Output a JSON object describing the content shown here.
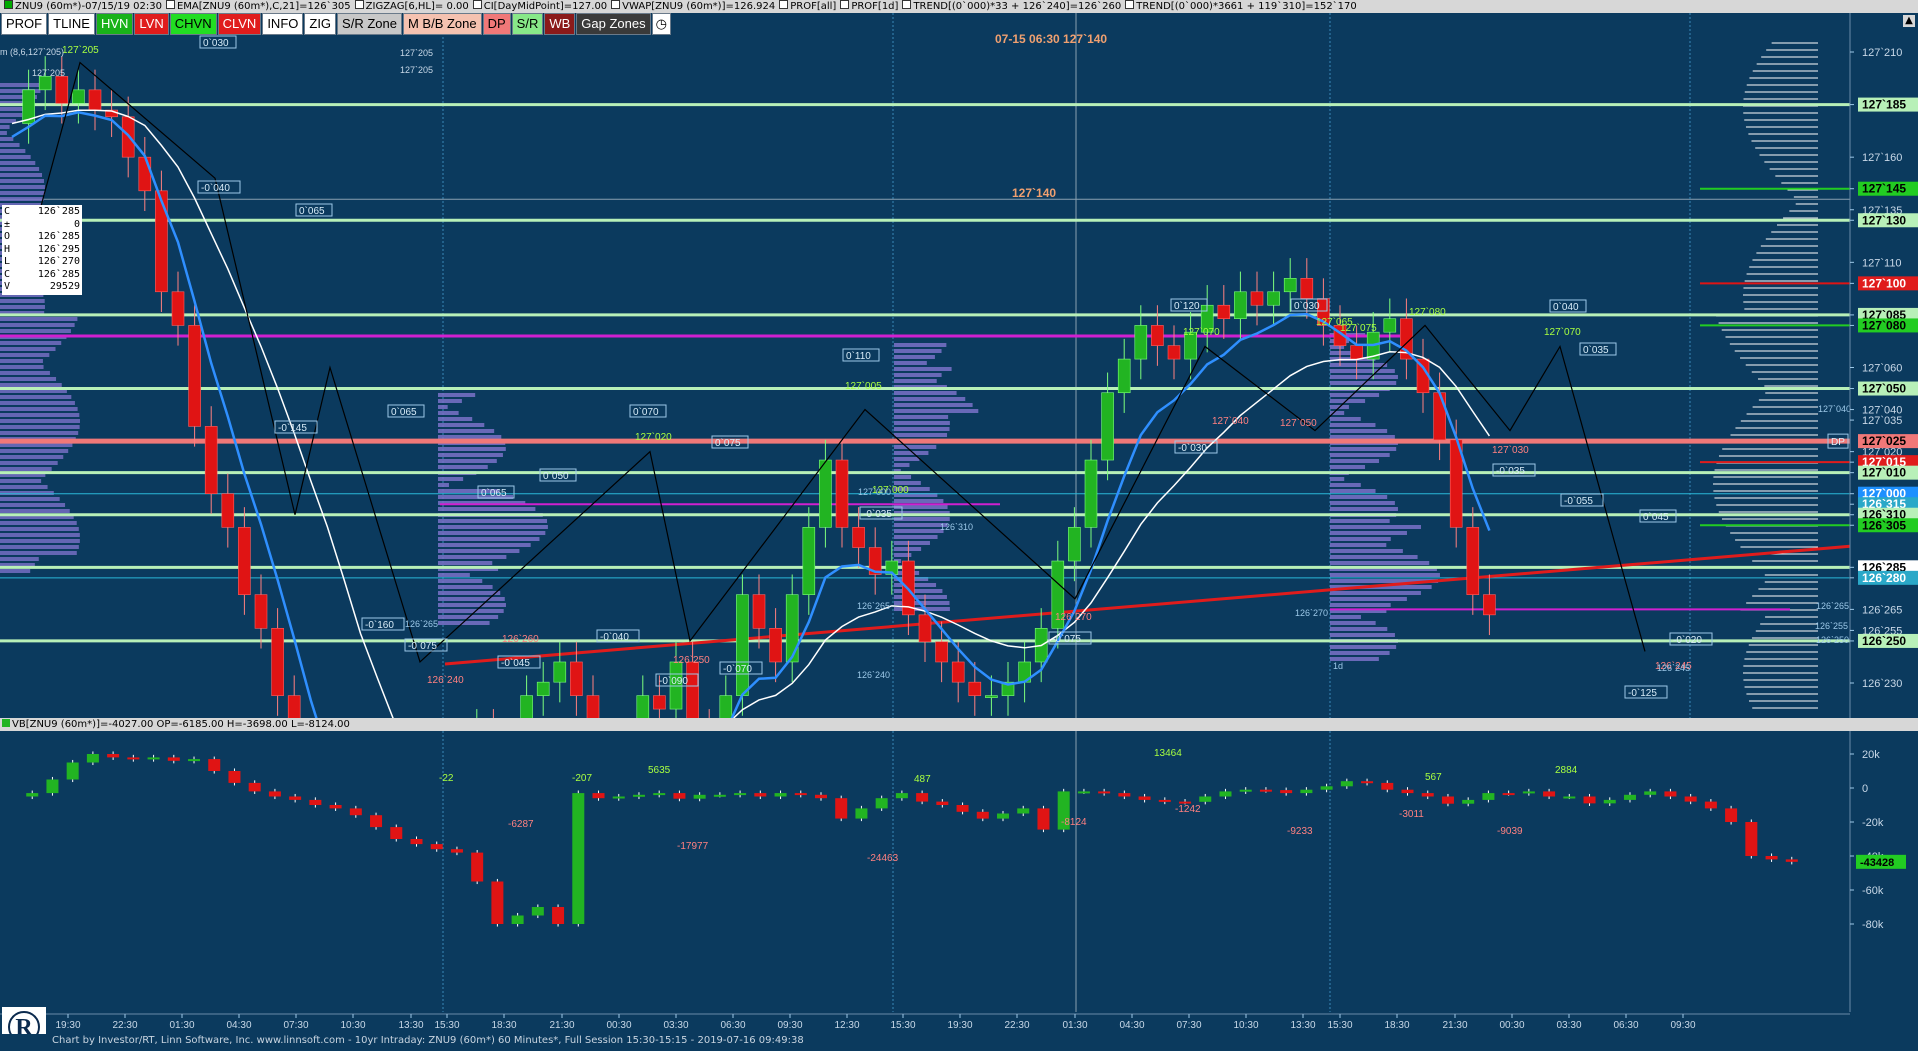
{
  "window": {
    "title_segments": [
      {
        "text": "ZNU9 (60m*)-07/15/19 02:30",
        "color": "#000000"
      },
      {
        "text": "EMA[ZNU9 (60m*),C,21]=126`305",
        "color": "#000000"
      },
      {
        "text": "ZIGZAG[6,HL]= 0.00",
        "color": "#000000"
      },
      {
        "text": "CI[DayMidPoint]=127.00",
        "color": "#000000"
      },
      {
        "text": "VWAP[ZNU9 (60m*)]=126.924",
        "color": "#000000"
      },
      {
        "text": "PROF[all]",
        "color": "#000000"
      },
      {
        "text": "PROF[1d]",
        "color": "#000000"
      },
      {
        "text": "TREND[(0`000)*33 + 126`240]=126`260",
        "color": "#000000"
      },
      {
        "text": "TREND[(0`000)*3661 + 119`310]=152`170",
        "color": "#000000"
      }
    ]
  },
  "toolbar": {
    "buttons": [
      {
        "label": "PROF",
        "bg": "#ffffff",
        "fg": "#000000"
      },
      {
        "label": "TLINE",
        "bg": "#ffffff",
        "fg": "#000000"
      },
      {
        "label": "HVN",
        "bg": "#19b219",
        "fg": "#ffffff"
      },
      {
        "label": "LVN",
        "bg": "#e01c1c",
        "fg": "#ffffff"
      },
      {
        "label": "CHVN",
        "bg": "#22dd22",
        "fg": "#000000"
      },
      {
        "label": "CLVN",
        "bg": "#e01c1c",
        "fg": "#ffffff"
      },
      {
        "label": "INFO",
        "bg": "#ffffff",
        "fg": "#000000"
      },
      {
        "label": "ZIG",
        "bg": "#ffffff",
        "fg": "#000000"
      },
      {
        "label": "S/R Zone",
        "bg": "#c8c8c8",
        "fg": "#000000"
      },
      {
        "label": "M B/B Zone",
        "bg": "#f5c2b0",
        "fg": "#000000"
      },
      {
        "label": "DP",
        "bg": "#f07878",
        "fg": "#000000"
      },
      {
        "label": "S/R",
        "bg": "#88e888",
        "fg": "#000000"
      },
      {
        "label": "WB",
        "bg": "#8b1a1a",
        "fg": "#ffffff"
      },
      {
        "label": "Gap Zones",
        "bg": "#3a3a3a",
        "fg": "#ffffff"
      }
    ],
    "clock_icon": "clock-icon"
  },
  "main": {
    "crosshair_label": "07-15 06:30  127`140",
    "cursor_price": "127`140",
    "price_axis": {
      "ticks": [
        "127`210",
        "127`185",
        "127`160",
        "127`145",
        "127`135",
        "127`130",
        "127`110",
        "127`100",
        "127`085",
        "127`080",
        "127`060",
        "127`050",
        "127`040",
        "127`035",
        "127`020",
        "127`015",
        "127`010",
        "127`000",
        "126`315",
        "126`310",
        "126`305",
        "126`285",
        "126`280",
        "126`265",
        "126`255",
        "126`250",
        "126`230"
      ],
      "badges": [
        {
          "text": "127`185",
          "bg": "#b8f0b8",
          "fg": "#000000"
        },
        {
          "text": "127`145",
          "bg": "#22cc22",
          "fg": "#000000"
        },
        {
          "text": "127`130",
          "bg": "#b8f0b8",
          "fg": "#000000"
        },
        {
          "text": "127`100",
          "bg": "#e01c1c",
          "fg": "#ffffff"
        },
        {
          "text": "127`085",
          "bg": "#b8f0b8",
          "fg": "#000000"
        },
        {
          "text": "127`080",
          "bg": "#22cc22",
          "fg": "#000000"
        },
        {
          "text": "127`050",
          "bg": "#b8f0b8",
          "fg": "#000000"
        },
        {
          "text": "127`025",
          "bg": "#f07878",
          "fg": "#000000"
        },
        {
          "text": "127`015",
          "bg": "#e01c1c",
          "fg": "#ffffff"
        },
        {
          "text": "127`010",
          "bg": "#b8f0b8",
          "fg": "#000000"
        },
        {
          "text": "127`000",
          "bg": "#1e90ff",
          "fg": "#ffffff"
        },
        {
          "text": "126`315",
          "bg": "#2aa8c8",
          "fg": "#ffffff"
        },
        {
          "text": "126`310",
          "bg": "#b8f0b8",
          "fg": "#000000"
        },
        {
          "text": "126`305",
          "bg": "#22cc22",
          "fg": "#000000"
        },
        {
          "text": "126`285",
          "bg": "#ffffff",
          "fg": "#000000"
        },
        {
          "text": "126`280",
          "bg": "#2aa8c8",
          "fg": "#ffffff"
        },
        {
          "text": "126`250",
          "bg": "#b8f0b8",
          "fg": "#000000"
        }
      ],
      "dp_label": "DP"
    },
    "ohlc_box": [
      {
        "k": "C",
        "v": "126`285"
      },
      {
        "k": "±",
        "v": "0"
      },
      {
        "k": "O",
        "v": "126`285"
      },
      {
        "k": "H",
        "v": "126`295"
      },
      {
        "k": "L",
        "v": "126`270"
      },
      {
        "k": "C",
        "v": "126`285"
      },
      {
        "k": "V",
        "v": "29529"
      }
    ],
    "profile_labels": [
      "m (8,6,127`205)",
      "127`205",
      "127`205",
      "127`205"
    ],
    "swing_labels": {
      "green": [
        "127`205",
        "127`020",
        "127`005",
        "127`070",
        "127`080",
        "127`075",
        "127`070",
        "127`065",
        "127`000"
      ],
      "red": [
        "126`260",
        "126`250",
        "126`240",
        "127`050",
        "126`270",
        "127`040",
        "127`030",
        "126`245"
      ]
    },
    "boxed_labels": [
      "0`030",
      "-0`040",
      "0`065",
      "-0`145",
      "0`065",
      "0`050",
      "0`065",
      "-0`160",
      "-0`075",
      "-0`045",
      "-0`040",
      "0`070",
      "0`075",
      "-0`090",
      "-0`070",
      "0`110",
      "-0`035",
      "-0`075",
      "0`120",
      "0`030",
      "-0`030",
      "0`040",
      "0`035",
      "-0`035",
      "-0`055",
      "0`045",
      "-0`020",
      "-0`125"
    ],
    "other_labels": [
      "126`265",
      "126`240",
      "126`310",
      "127`000",
      "126`265",
      "126`270",
      "126`255",
      "1d",
      "126`245",
      "126`250",
      "126`265",
      "127`040"
    ]
  },
  "lower": {
    "title": "VB[ZNU9 (60m*)]=-4027.00 OP=-6185.00 H=-3698.00 L=-8124.00",
    "axis_ticks": [
      "20k",
      "0",
      "-20k",
      "-40k",
      "-60k",
      "-80k"
    ],
    "current_value": "-43428",
    "value_labels": {
      "green": [
        "-22",
        "-207",
        "5635",
        "487",
        "13464",
        "567",
        "2884"
      ],
      "red": [
        "-6287",
        "-17977",
        "-24463",
        "-8124",
        "-1242",
        "-9233",
        "-3011",
        "-9039"
      ]
    }
  },
  "time_axis": {
    "labels": [
      "19:30",
      "22:30",
      "01:30",
      "04:30",
      "07:30",
      "10:30",
      "13:30",
      "15:30",
      "18:30",
      "21:30",
      "00:30",
      "03:30",
      "06:30",
      "09:30",
      "12:30",
      "15:30",
      "19:30",
      "22:30",
      "01:30",
      "04:30",
      "07:30",
      "10:30",
      "13:30",
      "15:30",
      "18:30",
      "21:30",
      "00:30",
      "03:30",
      "06:30",
      "09:30"
    ]
  },
  "footer": {
    "text": "Chart by Investor/RT, Linn Software, Inc. www.linnsoft.com - 10yr Intraday: ZNU9 (60m*) 60 Minutes*, Full Session 15:30-15:15 - 2019-07-16 09:49:38"
  },
  "colors": {
    "background": "#0b3a5e",
    "up_candle": "#22b422",
    "down_candle": "#e01414",
    "vwap": "#2f8fff",
    "ema": "#ffffff",
    "trendline": "#e01c1c",
    "sr_line": "#b8f0b8",
    "hvn": "#22cc22",
    "magenta": "#d020d0",
    "salmon": "#f07878",
    "cyan": "#2ab8d8",
    "profile": "#7a72c8"
  }
}
